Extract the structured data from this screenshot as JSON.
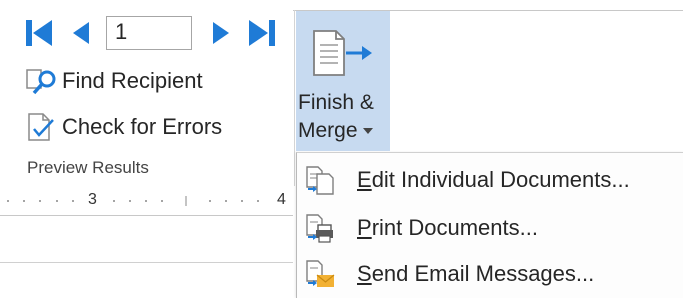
{
  "navigation": {
    "record_number": "1"
  },
  "commands": {
    "find_recipient": "Find Recipient",
    "check_for_errors": "Check for Errors"
  },
  "group": {
    "label": "Preview Results"
  },
  "finish_merge": {
    "line1": "Finish &",
    "line2": "Merge"
  },
  "ruler": {
    "mark_3": "3",
    "mark_4": "4"
  },
  "menu": {
    "items": [
      {
        "accel": "E",
        "rest": "dit Individual Documents...",
        "icon": "edit-documents-icon"
      },
      {
        "accel": "P",
        "rest": "rint Documents...",
        "icon": "print-documents-icon"
      },
      {
        "accel": "S",
        "rest": "end Email Messages...",
        "icon": "send-email-icon"
      }
    ]
  },
  "colors": {
    "nav_blue": "#1f7bd6",
    "merge_highlight": "#c7daf0",
    "envelope": "#f2b134"
  }
}
